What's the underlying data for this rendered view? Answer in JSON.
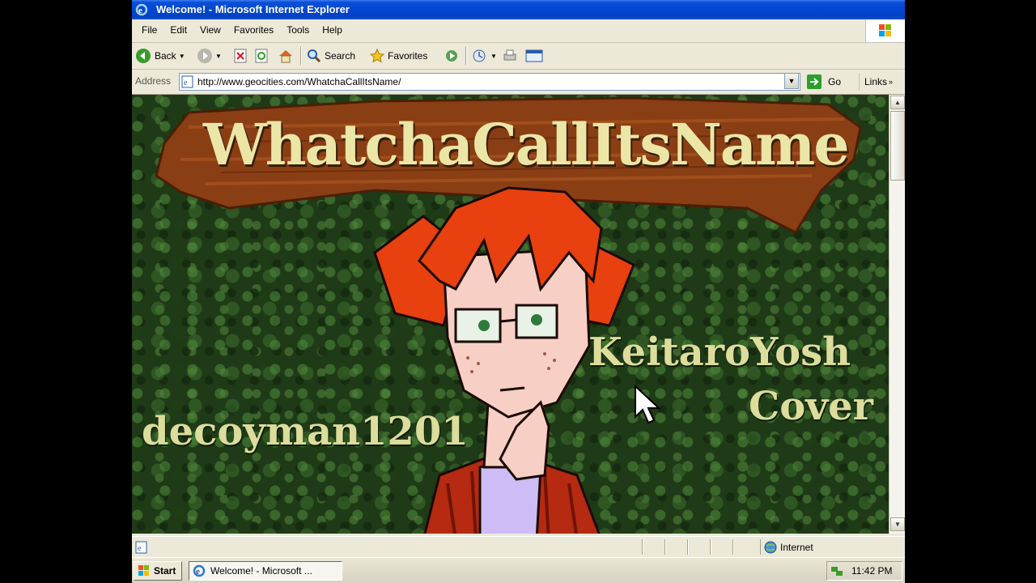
{
  "window": {
    "title": "Welcome! - Microsoft Internet Explorer"
  },
  "menu": {
    "items": [
      "File",
      "Edit",
      "View",
      "Favorites",
      "Tools",
      "Help"
    ]
  },
  "toolbar": {
    "back_label": "Back",
    "search_label": "Search",
    "favorites_label": "Favorites"
  },
  "address": {
    "label": "Address",
    "url": "http://www.geocities.com/WhatchaCallItsName/",
    "go_label": "Go",
    "links_label": "Links"
  },
  "page": {
    "site_title": "WhatchaCallItsName",
    "credit_left": "decoyman1201",
    "credit_right_line1": "KeitaroYosh",
    "credit_right_line2": "Cover"
  },
  "status": {
    "zone_label": "Internet"
  },
  "taskbar": {
    "start_label": "Start",
    "task_label": "Welcome! - Microsoft ...",
    "clock": "11:42 PM"
  },
  "colors": {
    "titlebar": "#0347d0",
    "title_text": "#ece6a6",
    "credit_text": "#dcdc9c",
    "hair": "#e8400f"
  }
}
